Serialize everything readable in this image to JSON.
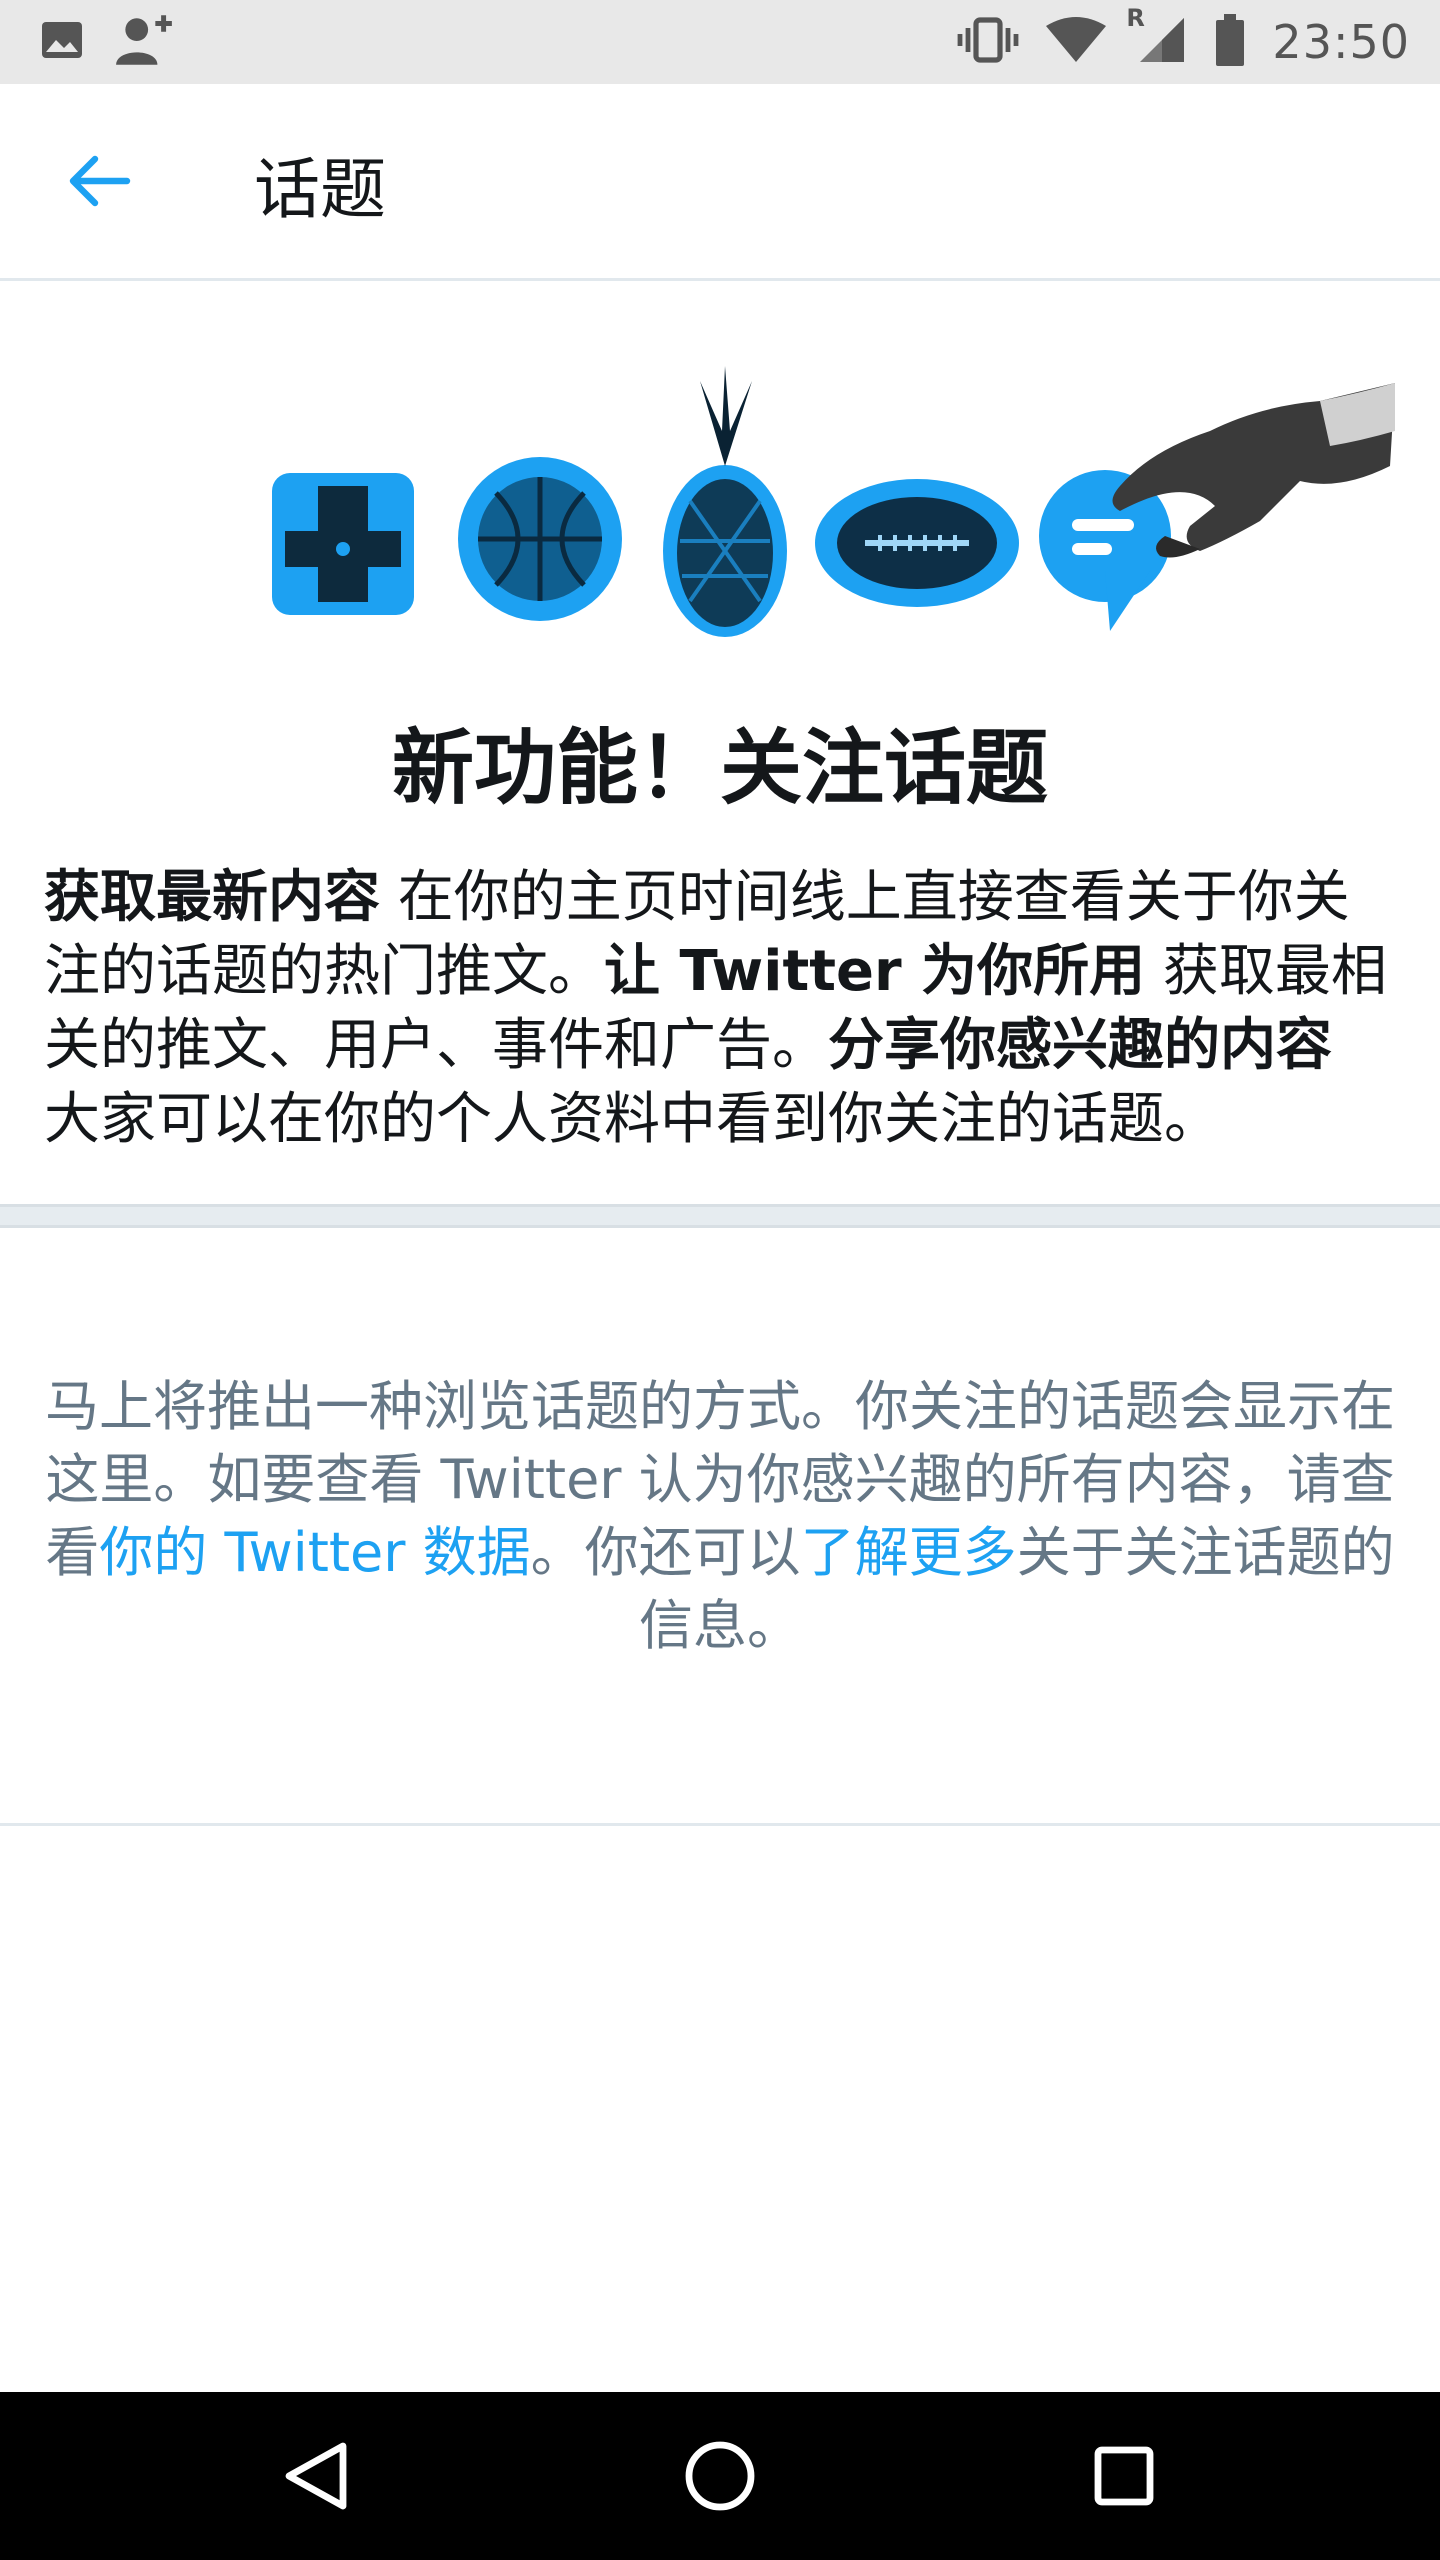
{
  "status_bar": {
    "time": "23:50",
    "left_icons": [
      "image-icon",
      "add-person-icon"
    ],
    "right_icons": [
      "vibrate-icon",
      "wifi-icon",
      "signal-icon",
      "battery-icon"
    ],
    "roaming_label": "R"
  },
  "toolbar": {
    "back_icon": "arrow-left-icon",
    "title": "话题"
  },
  "hero": {
    "illustration_icons": [
      "gamepad-icon",
      "basketball-icon",
      "pineapple-icon",
      "football-icon",
      "chat-bubble-icon",
      "hand-icon"
    ],
    "title": "新功能！关注话题",
    "body": {
      "p1_bold": "获取最新内容",
      "p1_text": " 在你的主页时间线上直接查看关于你关注的话题的热门推文。",
      "p2_bold": "让 Twitter 为你所用",
      "p2_text": " 获取最相关的推文、用户、事件和广告。",
      "p3_bold": "分享你感兴趣的内容",
      "p3_text": " 大家可以在你的个人资料中看到你关注的话题。"
    }
  },
  "empty_state": {
    "text_before": "马上将推出一种浏览话题的方式。你关注的话题会显示在这里。如要查看 Twitter 认为你感兴趣的所有内容，请查看",
    "link1": "你的 Twitter 数据",
    "text_middle": "。你还可以",
    "link2": "了解更多",
    "text_after": "关于关注话题的信息。"
  },
  "nav_bar": {
    "buttons": [
      "back-triangle-icon",
      "home-circle-icon",
      "recents-square-icon"
    ]
  },
  "colors": {
    "accent": "#1da1f2",
    "text_primary": "#14171a",
    "text_secondary": "#657786",
    "divider": "#e6ecf0"
  }
}
